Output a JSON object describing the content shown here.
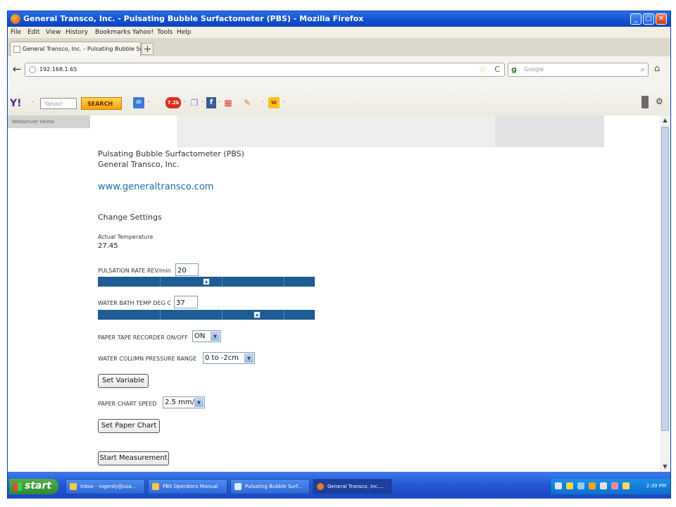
{
  "window": {
    "title": "General Transco, Inc. - Pulsating Bubble Surfactometer (PBS) - Mozilla Firefox",
    "minimize": "_",
    "maximize": "□",
    "close": "✕"
  },
  "menubar": {
    "items": [
      "File",
      "Edit",
      "View",
      "History",
      "Bookmarks",
      "Yahoo!",
      "Tools",
      "Help"
    ]
  },
  "tab": {
    "label": "General Transco, Inc. - Pulsating Bubble Sur...",
    "new_tab": "+"
  },
  "navbar": {
    "back": "←",
    "url": "192.168.1.65",
    "star": "☆",
    "reload": "C",
    "search_engine": "g",
    "search_placeholder": "Google",
    "search_icon": "⌕",
    "home": "⌂"
  },
  "yahoo_toolbar": {
    "logo": "Y!",
    "search_placeholder": "Yahoo!",
    "search_button": "SEARCH",
    "mail": "✉",
    "badge": "7.2k",
    "doc": "❐",
    "fb": "f",
    "cal": "▦",
    "note": "✎",
    "extra": "w",
    "separator": "·",
    "gear": "⚙"
  },
  "sidebar": {
    "webserver_home": "Webserver Home"
  },
  "page": {
    "title_line1": "Pulsating Bubble Surfactometer (PBS)",
    "title_line2": "General Transco, Inc.",
    "website": "www.generaltransco.com",
    "section": "Change Settings",
    "actual_temp_label": "Actual Temperature",
    "actual_temp_value": "27.45",
    "pulsation_label": "PULSATION RATE REV/min",
    "pulsation_value": "20",
    "pulsation_slider_fraction": 0.5,
    "water_bath_label": "WATER BATH TEMP DEG C",
    "water_bath_value": "37",
    "water_bath_slider_fraction": 0.74,
    "paper_tape_label": "PAPER TAPE RECORDER ON/OFF",
    "paper_tape_value": "ON",
    "water_column_label": "WATER COLUMN PRESSURE RANGE",
    "water_column_value": "0 to -2cm",
    "set_variable_button": "Set Variable",
    "paper_chart_label": "PAPER CHART SPEED",
    "paper_chart_value": "2.5 mm/s",
    "set_paper_chart_button": "Set Paper Chart",
    "start_measurement_button": "Start Measurement",
    "dropdown_arrow": "▼"
  },
  "scrollbar": {
    "up": "▲",
    "down": "▼"
  },
  "taskbar": {
    "start": "start",
    "items": [
      "Inbox - rogerdy@usa...",
      "PBS Operators Manual",
      "Pulsating Bubble Surf...",
      "General Transco, Inc...."
    ],
    "clock": "2:39 PM"
  },
  "colors": {
    "slider": "#1d5c94",
    "link": "#1c6aa3",
    "titlebar": "#1250d0",
    "taskbar": "#2456d6"
  }
}
